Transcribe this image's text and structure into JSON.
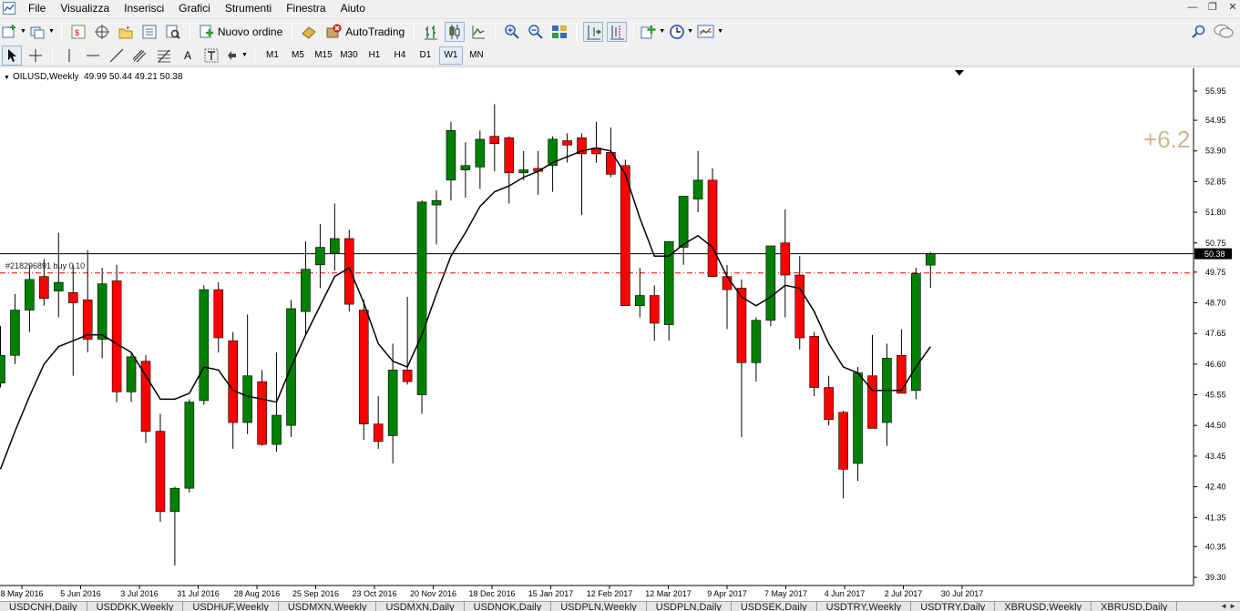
{
  "menu": {
    "items": [
      "File",
      "Visualizza",
      "Inserisci",
      "Grafici",
      "Strumenti",
      "Finestra",
      "Aiuto"
    ]
  },
  "toolbar": {
    "new_order_label": "Nuovo ordine",
    "autotrading_label": "AutoTrading",
    "timeframes": [
      "M1",
      "M5",
      "M15",
      "M30",
      "H1",
      "H4",
      "D1",
      "W1",
      "MN"
    ],
    "active_timeframe": "W1",
    "draw_text_tool": "A"
  },
  "chart": {
    "symbol_label": "OILUSD,Weekly",
    "ohlc_label": "49.99 50.44 49.21 50.38",
    "order_label": "#218296891 buy 0.10",
    "current_price_label": "50.38",
    "profit_label": "+6.2",
    "price_ticks": [
      "55.95",
      "54.95",
      "53.90",
      "52.85",
      "51.80",
      "50.75",
      "49.75",
      "48.70",
      "47.65",
      "46.60",
      "45.55",
      "44.50",
      "43.45",
      "42.40",
      "41.35",
      "40.35",
      "39.30"
    ],
    "date_ticks": [
      "8 May 2016",
      "5 Jun 2016",
      "3 Jul 2016",
      "31 Jul 2016",
      "28 Aug 2016",
      "25 Sep 2016",
      "23 Oct 2016",
      "20 Nov 2016",
      "18 Dec 2016",
      "15 Jan 2017",
      "12 Feb 2017",
      "12 Mar 2017",
      "9 Apr 2017",
      "7 May 2017",
      "4 Jun 2017",
      "2 Jul 2017",
      "30 Jul 2017"
    ],
    "colors": {
      "up": "#008000",
      "down": "#ff0000",
      "ma": "#000000",
      "order_line": "#ff0000",
      "price_line": "#000000"
    }
  },
  "chart_data": {
    "type": "candlestick",
    "title": "OILUSD,Weekly",
    "ylim": [
      39.3,
      56.4
    ],
    "open_position_price": 49.72,
    "current_price": 50.38,
    "candles": [
      {
        "o": 45.95,
        "h": 47.9,
        "l": 45.8,
        "c": 46.9
      },
      {
        "o": 46.9,
        "h": 49.0,
        "l": 46.6,
        "c": 48.45
      },
      {
        "o": 48.45,
        "h": 50.0,
        "l": 47.7,
        "c": 49.5
      },
      {
        "o": 49.6,
        "h": 50.2,
        "l": 48.6,
        "c": 48.85
      },
      {
        "o": 49.1,
        "h": 51.1,
        "l": 48.2,
        "c": 49.4
      },
      {
        "o": 49.05,
        "h": 50.0,
        "l": 46.2,
        "c": 48.7
      },
      {
        "o": 48.8,
        "h": 50.5,
        "l": 47.0,
        "c": 47.45
      },
      {
        "o": 47.45,
        "h": 49.9,
        "l": 46.8,
        "c": 49.35
      },
      {
        "o": 49.45,
        "h": 50.0,
        "l": 45.3,
        "c": 45.65
      },
      {
        "o": 45.65,
        "h": 47.0,
        "l": 45.3,
        "c": 46.85
      },
      {
        "o": 46.7,
        "h": 46.9,
        "l": 43.9,
        "c": 44.3
      },
      {
        "o": 44.3,
        "h": 44.9,
        "l": 41.2,
        "c": 41.55
      },
      {
        "o": 41.55,
        "h": 42.4,
        "l": 39.7,
        "c": 42.35
      },
      {
        "o": 42.35,
        "h": 45.4,
        "l": 42.2,
        "c": 45.3
      },
      {
        "o": 45.35,
        "h": 49.3,
        "l": 45.2,
        "c": 49.15
      },
      {
        "o": 49.15,
        "h": 49.4,
        "l": 47.0,
        "c": 47.5
      },
      {
        "o": 47.4,
        "h": 47.7,
        "l": 43.7,
        "c": 44.6
      },
      {
        "o": 44.6,
        "h": 48.3,
        "l": 44.2,
        "c": 46.2
      },
      {
        "o": 46.0,
        "h": 46.4,
        "l": 43.8,
        "c": 43.85
      },
      {
        "o": 43.85,
        "h": 47.0,
        "l": 43.6,
        "c": 44.85
      },
      {
        "o": 44.5,
        "h": 48.8,
        "l": 44.1,
        "c": 48.5
      },
      {
        "o": 48.4,
        "h": 50.8,
        "l": 47.6,
        "c": 49.85
      },
      {
        "o": 50.0,
        "h": 51.4,
        "l": 49.2,
        "c": 50.6
      },
      {
        "o": 50.4,
        "h": 52.1,
        "l": 49.8,
        "c": 50.9
      },
      {
        "o": 50.9,
        "h": 51.2,
        "l": 48.4,
        "c": 48.65
      },
      {
        "o": 48.45,
        "h": 48.8,
        "l": 44.0,
        "c": 44.55
      },
      {
        "o": 44.55,
        "h": 45.5,
        "l": 43.7,
        "c": 43.95
      },
      {
        "o": 44.15,
        "h": 47.3,
        "l": 43.2,
        "c": 46.4
      },
      {
        "o": 46.4,
        "h": 48.9,
        "l": 45.9,
        "c": 46.0
      },
      {
        "o": 45.55,
        "h": 52.2,
        "l": 44.9,
        "c": 52.15
      },
      {
        "o": 52.05,
        "h": 52.55,
        "l": 50.7,
        "c": 52.2
      },
      {
        "o": 52.9,
        "h": 54.9,
        "l": 52.2,
        "c": 54.6
      },
      {
        "o": 53.25,
        "h": 54.2,
        "l": 52.3,
        "c": 53.4
      },
      {
        "o": 53.35,
        "h": 54.6,
        "l": 52.6,
        "c": 54.3
      },
      {
        "o": 54.4,
        "h": 55.5,
        "l": 53.2,
        "c": 54.15
      },
      {
        "o": 54.35,
        "h": 54.4,
        "l": 52.1,
        "c": 53.15
      },
      {
        "o": 53.15,
        "h": 53.9,
        "l": 52.9,
        "c": 53.25
      },
      {
        "o": 53.3,
        "h": 53.9,
        "l": 52.4,
        "c": 53.2
      },
      {
        "o": 53.4,
        "h": 54.4,
        "l": 52.5,
        "c": 54.3
      },
      {
        "o": 54.25,
        "h": 54.5,
        "l": 53.5,
        "c": 54.1
      },
      {
        "o": 54.35,
        "h": 54.5,
        "l": 51.7,
        "c": 53.8
      },
      {
        "o": 54.0,
        "h": 54.9,
        "l": 53.5,
        "c": 53.8
      },
      {
        "o": 53.85,
        "h": 54.7,
        "l": 53.0,
        "c": 53.1
      },
      {
        "o": 53.4,
        "h": 53.6,
        "l": 48.8,
        "c": 48.6
      },
      {
        "o": 48.6,
        "h": 49.9,
        "l": 48.2,
        "c": 48.95
      },
      {
        "o": 48.95,
        "h": 49.3,
        "l": 47.4,
        "c": 48.0
      },
      {
        "o": 47.95,
        "h": 50.8,
        "l": 47.4,
        "c": 50.8
      },
      {
        "o": 50.6,
        "h": 51.5,
        "l": 50.0,
        "c": 52.35
      },
      {
        "o": 52.25,
        "h": 53.9,
        "l": 51.8,
        "c": 52.9
      },
      {
        "o": 52.9,
        "h": 53.3,
        "l": 49.6,
        "c": 49.6
      },
      {
        "o": 49.6,
        "h": 50.0,
        "l": 47.8,
        "c": 49.15
      },
      {
        "o": 49.2,
        "h": 49.5,
        "l": 44.1,
        "c": 46.65
      },
      {
        "o": 46.65,
        "h": 48.2,
        "l": 46.0,
        "c": 48.1
      },
      {
        "o": 48.1,
        "h": 50.6,
        "l": 47.9,
        "c": 50.65
      },
      {
        "o": 50.75,
        "h": 51.9,
        "l": 48.2,
        "c": 49.65
      },
      {
        "o": 49.65,
        "h": 50.3,
        "l": 47.1,
        "c": 47.5
      },
      {
        "o": 47.55,
        "h": 47.7,
        "l": 45.5,
        "c": 45.8
      },
      {
        "o": 45.8,
        "h": 46.2,
        "l": 44.5,
        "c": 44.7
      },
      {
        "o": 44.95,
        "h": 45.0,
        "l": 42.0,
        "c": 43.0
      },
      {
        "o": 43.2,
        "h": 46.5,
        "l": 42.6,
        "c": 46.3
      },
      {
        "o": 46.2,
        "h": 47.6,
        "l": 44.4,
        "c": 44.4
      },
      {
        "o": 44.6,
        "h": 47.3,
        "l": 43.8,
        "c": 46.8
      },
      {
        "o": 46.9,
        "h": 47.8,
        "l": 45.6,
        "c": 45.6
      },
      {
        "o": 45.7,
        "h": 49.9,
        "l": 45.4,
        "c": 49.7
      },
      {
        "o": 49.99,
        "h": 50.44,
        "l": 49.21,
        "c": 50.38
      }
    ],
    "moving_average": [
      43.0,
      44.3,
      45.5,
      46.6,
      47.2,
      47.4,
      47.6,
      47.6,
      47.3,
      47.0,
      46.2,
      45.4,
      45.4,
      45.6,
      46.5,
      46.4,
      45.7,
      45.5,
      45.4,
      45.3,
      46.5,
      47.6,
      48.6,
      49.6,
      49.9,
      48.7,
      47.3,
      46.7,
      46.5,
      47.6,
      49.0,
      50.3,
      51.1,
      52.0,
      52.5,
      52.7,
      53.0,
      53.2,
      53.5,
      53.7,
      53.9,
      54.0,
      53.9,
      53.1,
      51.6,
      50.3,
      50.3,
      50.7,
      51.0,
      50.6,
      49.6,
      48.9,
      48.6,
      48.9,
      49.3,
      49.2,
      48.4,
      47.3,
      46.5,
      46.3,
      45.7,
      45.7,
      45.7,
      46.5,
      47.2
    ]
  },
  "tabs": [
    "USDCNH,Daily",
    "USDDKK,Weekly",
    "USDHUF,Weekly",
    "USDMXN,Weekly",
    "USDMXN,Daily",
    "USDNOK,Daily",
    "USDPLN,Weekly",
    "USDPLN,Daily",
    "USDSEK,Daily",
    "USDTRY,Weekly",
    "USDTRY,Daily",
    "XBRUSD,Weekly",
    "XBRUSD,Daily"
  ]
}
